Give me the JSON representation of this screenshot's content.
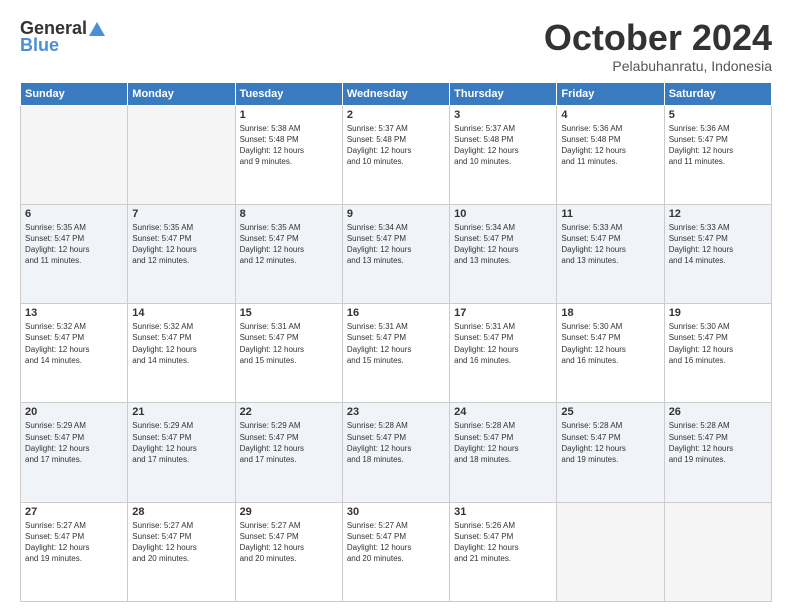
{
  "logo": {
    "general": "General",
    "blue": "Blue"
  },
  "header": {
    "month": "October 2024",
    "location": "Pelabuhanratu, Indonesia"
  },
  "weekdays": [
    "Sunday",
    "Monday",
    "Tuesday",
    "Wednesday",
    "Thursday",
    "Friday",
    "Saturday"
  ],
  "weeks": [
    [
      {
        "day": "",
        "empty": true
      },
      {
        "day": "",
        "empty": true
      },
      {
        "day": "1",
        "sunrise": "5:38 AM",
        "sunset": "5:48 PM",
        "daylight": "12 hours and 9 minutes."
      },
      {
        "day": "2",
        "sunrise": "5:37 AM",
        "sunset": "5:48 PM",
        "daylight": "12 hours and 10 minutes."
      },
      {
        "day": "3",
        "sunrise": "5:37 AM",
        "sunset": "5:48 PM",
        "daylight": "12 hours and 10 minutes."
      },
      {
        "day": "4",
        "sunrise": "5:36 AM",
        "sunset": "5:48 PM",
        "daylight": "12 hours and 11 minutes."
      },
      {
        "day": "5",
        "sunrise": "5:36 AM",
        "sunset": "5:47 PM",
        "daylight": "12 hours and 11 minutes."
      }
    ],
    [
      {
        "day": "6",
        "sunrise": "5:35 AM",
        "sunset": "5:47 PM",
        "daylight": "12 hours and 11 minutes."
      },
      {
        "day": "7",
        "sunrise": "5:35 AM",
        "sunset": "5:47 PM",
        "daylight": "12 hours and 12 minutes."
      },
      {
        "day": "8",
        "sunrise": "5:35 AM",
        "sunset": "5:47 PM",
        "daylight": "12 hours and 12 minutes."
      },
      {
        "day": "9",
        "sunrise": "5:34 AM",
        "sunset": "5:47 PM",
        "daylight": "12 hours and 13 minutes."
      },
      {
        "day": "10",
        "sunrise": "5:34 AM",
        "sunset": "5:47 PM",
        "daylight": "12 hours and 13 minutes."
      },
      {
        "day": "11",
        "sunrise": "5:33 AM",
        "sunset": "5:47 PM",
        "daylight": "12 hours and 13 minutes."
      },
      {
        "day": "12",
        "sunrise": "5:33 AM",
        "sunset": "5:47 PM",
        "daylight": "12 hours and 14 minutes."
      }
    ],
    [
      {
        "day": "13",
        "sunrise": "5:32 AM",
        "sunset": "5:47 PM",
        "daylight": "12 hours and 14 minutes."
      },
      {
        "day": "14",
        "sunrise": "5:32 AM",
        "sunset": "5:47 PM",
        "daylight": "12 hours and 14 minutes."
      },
      {
        "day": "15",
        "sunrise": "5:31 AM",
        "sunset": "5:47 PM",
        "daylight": "12 hours and 15 minutes."
      },
      {
        "day": "16",
        "sunrise": "5:31 AM",
        "sunset": "5:47 PM",
        "daylight": "12 hours and 15 minutes."
      },
      {
        "day": "17",
        "sunrise": "5:31 AM",
        "sunset": "5:47 PM",
        "daylight": "12 hours and 16 minutes."
      },
      {
        "day": "18",
        "sunrise": "5:30 AM",
        "sunset": "5:47 PM",
        "daylight": "12 hours and 16 minutes."
      },
      {
        "day": "19",
        "sunrise": "5:30 AM",
        "sunset": "5:47 PM",
        "daylight": "12 hours and 16 minutes."
      }
    ],
    [
      {
        "day": "20",
        "sunrise": "5:29 AM",
        "sunset": "5:47 PM",
        "daylight": "12 hours and 17 minutes."
      },
      {
        "day": "21",
        "sunrise": "5:29 AM",
        "sunset": "5:47 PM",
        "daylight": "12 hours and 17 minutes."
      },
      {
        "day": "22",
        "sunrise": "5:29 AM",
        "sunset": "5:47 PM",
        "daylight": "12 hours and 17 minutes."
      },
      {
        "day": "23",
        "sunrise": "5:28 AM",
        "sunset": "5:47 PM",
        "daylight": "12 hours and 18 minutes."
      },
      {
        "day": "24",
        "sunrise": "5:28 AM",
        "sunset": "5:47 PM",
        "daylight": "12 hours and 18 minutes."
      },
      {
        "day": "25",
        "sunrise": "5:28 AM",
        "sunset": "5:47 PM",
        "daylight": "12 hours and 19 minutes."
      },
      {
        "day": "26",
        "sunrise": "5:28 AM",
        "sunset": "5:47 PM",
        "daylight": "12 hours and 19 minutes."
      }
    ],
    [
      {
        "day": "27",
        "sunrise": "5:27 AM",
        "sunset": "5:47 PM",
        "daylight": "12 hours and 19 minutes."
      },
      {
        "day": "28",
        "sunrise": "5:27 AM",
        "sunset": "5:47 PM",
        "daylight": "12 hours and 20 minutes."
      },
      {
        "day": "29",
        "sunrise": "5:27 AM",
        "sunset": "5:47 PM",
        "daylight": "12 hours and 20 minutes."
      },
      {
        "day": "30",
        "sunrise": "5:27 AM",
        "sunset": "5:47 PM",
        "daylight": "12 hours and 20 minutes."
      },
      {
        "day": "31",
        "sunrise": "5:26 AM",
        "sunset": "5:47 PM",
        "daylight": "12 hours and 21 minutes."
      },
      {
        "day": "",
        "empty": true
      },
      {
        "day": "",
        "empty": true
      }
    ]
  ],
  "labels": {
    "sunrise": "Sunrise:",
    "sunset": "Sunset:",
    "daylight": "Daylight:"
  }
}
